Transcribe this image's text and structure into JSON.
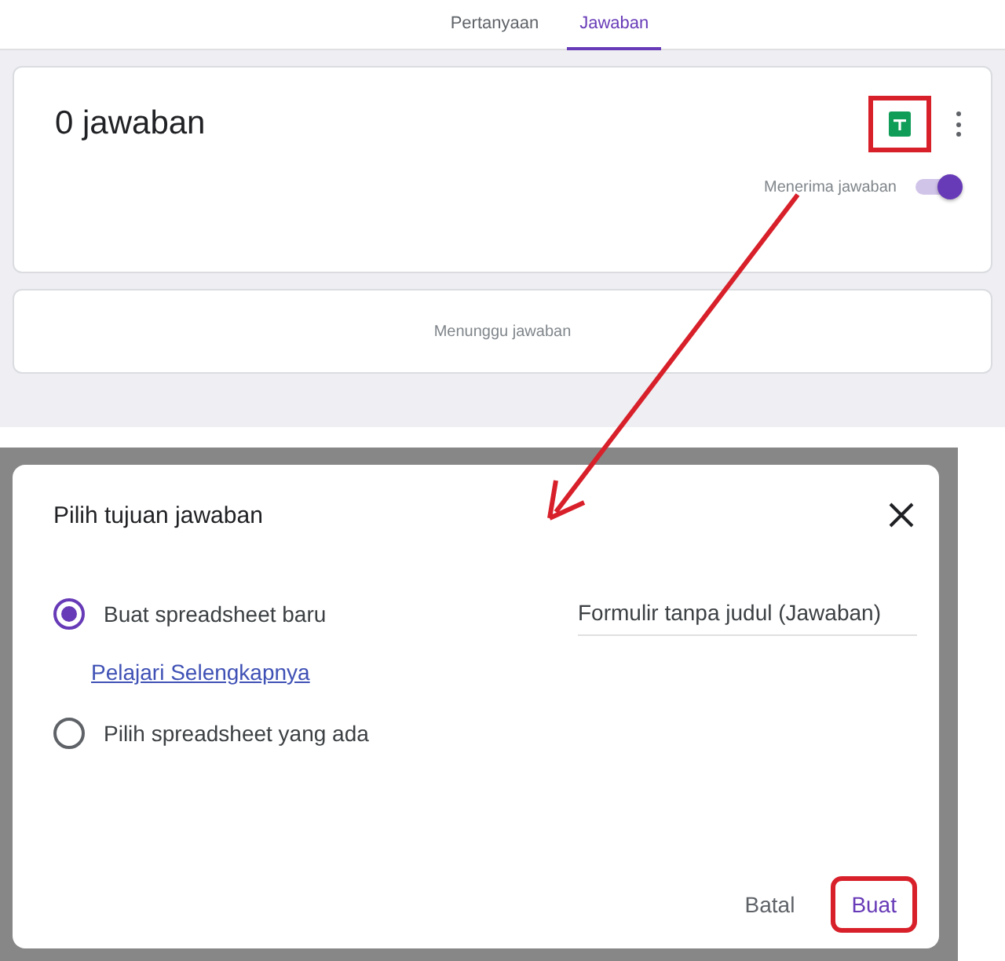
{
  "tabs": [
    {
      "label": "Pertanyaan",
      "selected": false
    },
    {
      "label": "Jawaban",
      "selected": true
    }
  ],
  "summary": {
    "title": "0 jawaban",
    "sheets_button": {
      "highlighted": true
    },
    "accepting": {
      "label": "Menerima jawaban",
      "on": true
    }
  },
  "status": {
    "text": "Menunggu jawaban"
  },
  "dialog": {
    "title": "Pilih tujuan jawaban",
    "options": [
      {
        "label": "Buat spreadsheet baru",
        "selected": true,
        "field_value": "Formulir tanpa judul (Jawaban)",
        "link": "Pelajari Selengkapnya"
      },
      {
        "label": "Pilih spreadsheet yang ada",
        "selected": false
      }
    ],
    "buttons": [
      {
        "label": "Batal",
        "highlighted": false
      },
      {
        "label": "Buat",
        "highlighted": true
      }
    ]
  }
}
